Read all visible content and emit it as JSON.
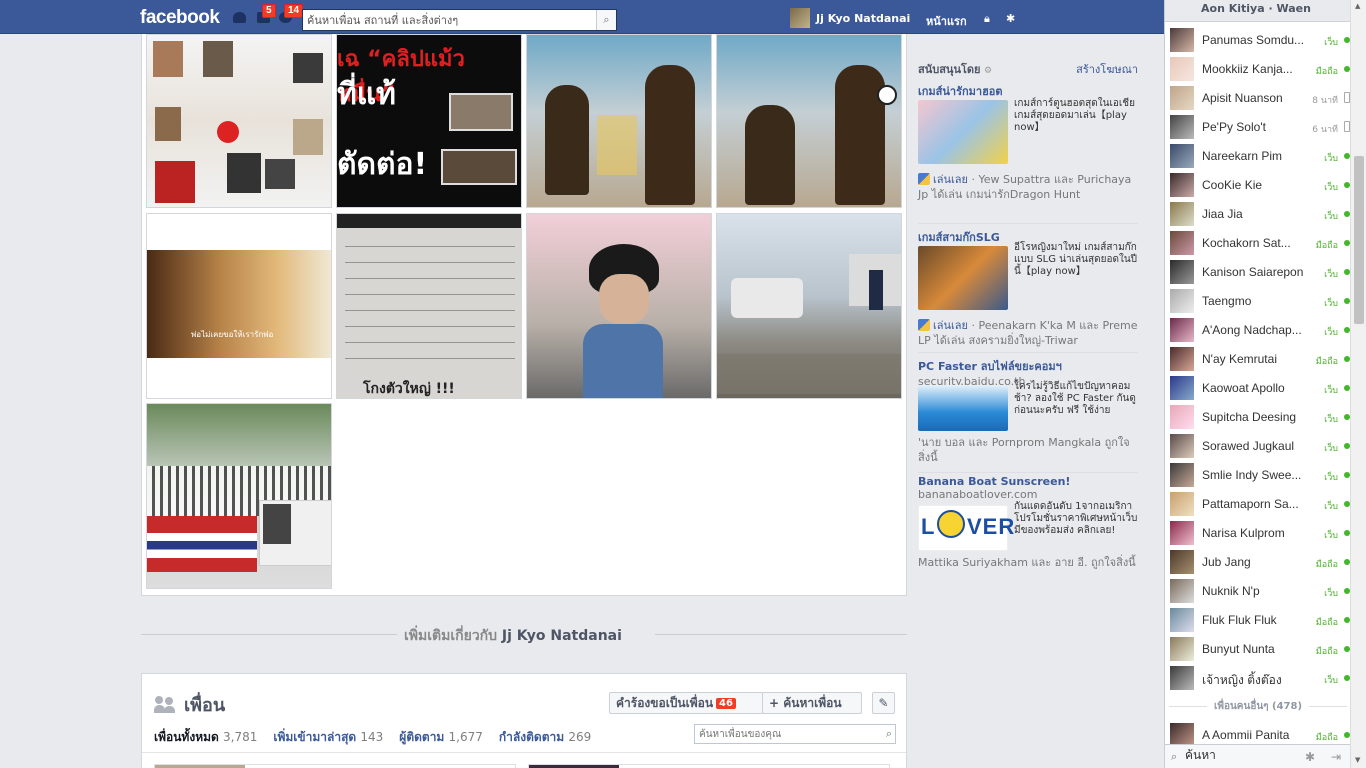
{
  "topbar": {
    "logo": "facebook",
    "friend_requests_count": "",
    "messages_count": "5",
    "notifications_count": "14",
    "search_placeholder": "ค้นหาเพื่อน สถานที่ และสิ่งต่างๆ",
    "profile_name": "Jj Kyo Natdanai",
    "home_label": "หน้าแรก"
  },
  "more_about": {
    "prefix": "เพิ่มเติมเกี่ยวกับ",
    "name": "Jj Kyo Natdanai"
  },
  "friends": {
    "title": "เพื่อน",
    "requests_label": "คำร้องขอเป็นเพื่อน",
    "requests_count": "46",
    "find_label": "+ ค้นหาเพื่อน",
    "tabs": [
      {
        "label": "เพื่อนทั้งหมด",
        "count": "3,781"
      },
      {
        "label": "เพิ่มเข้ามาล่าสุด",
        "count": "143"
      },
      {
        "label": "ผู้ติดตาม",
        "count": "1,677"
      },
      {
        "label": "กำลังติดตาม",
        "count": "269"
      }
    ],
    "search_placeholder": "ค้นหาเพื่อนของคุณ"
  },
  "sponsored": {
    "label": "สนับสนุนโดย",
    "create_ad": "สร้างโฆษณา",
    "ads": [
      {
        "title": "เกมส์น่ารักมาฮอต",
        "body": "เกมส์การ์ตูนฮอตสุดในเอเชีย เกมส์สุดยอดมาเล่น【play now】",
        "social_link": "เล่นเลย",
        "social_text": " · Yew Supattra และ Purichaya Jp ได้เล่น เกมน่ารักDragon Hunt"
      },
      {
        "title": "เกมส์สามก๊กSLG",
        "body": "อีโรหญิงมาใหม่ เกมส์สามก๊กแบบ SLG น่าเล่นสุดยอดในปีนี้【play now】",
        "social_link": "เล่นเลย",
        "social_text": " · Peenakarn K'ka M และ Preme LP ได้เล่น สงครามยิ่งใหญ่-Triwar"
      },
      {
        "title": "PC Faster ลบไฟล์ขยะคอมฯ",
        "url": "security.baidu.co.th",
        "body": "ใครไม่รู้วิธีแก้ไขปัญหาคอมช้า? ลองใช้ PC Faster กันดูก่อนนะครับ ฟรี ใช้ง่าย",
        "social_text": "'นาย บอล และ Pornprom Mangkala ถูกใจสิ่งนี้"
      },
      {
        "title": "Banana Boat Sunscreen!",
        "url": "bananaboatlover.com",
        "body": "กันแดดอันดับ 1จากอเมริกา โปรโมชั่นราคาพิเศษหน้าเว็บ มีของพร้อมส่ง คลิกเลย!",
        "social_text": "Mattika Suriyakham และ อาย อี. ถูกใจสิ่งนี้"
      }
    ]
  },
  "chat": {
    "top_partial": "Aon Kitiya · Waen",
    "contacts": [
      {
        "name": "Panumas Somdu...",
        "status": "เว็บ",
        "online": true
      },
      {
        "name": "Mookkiiz Kanja...",
        "status": "มือถือ",
        "online": true
      },
      {
        "name": "Apisit Nuanson",
        "status": "8 นาที",
        "online": false
      },
      {
        "name": "Pe'Py Solo't",
        "status": "6 นาที",
        "online": false
      },
      {
        "name": "Nareekarn Pim",
        "status": "เว็บ",
        "online": true
      },
      {
        "name": "CooKie Kie",
        "status": "เว็บ",
        "online": true
      },
      {
        "name": "Jiaa Jia",
        "status": "เว็บ",
        "online": true
      },
      {
        "name": "Kochakorn Sat...",
        "status": "มือถือ",
        "online": true
      },
      {
        "name": "Kanison Saiarepon",
        "status": "เว็บ",
        "online": true
      },
      {
        "name": "Taengmo",
        "status": "เว็บ",
        "online": true
      },
      {
        "name": "A'Aong Nadchap...",
        "status": "เว็บ",
        "online": true
      },
      {
        "name": "N'ay Kemrutai",
        "status": "มือถือ",
        "online": true
      },
      {
        "name": "Kaowoat Apollo",
        "status": "เว็บ",
        "online": true
      },
      {
        "name": "Supitcha Deesing",
        "status": "เว็บ",
        "online": true
      },
      {
        "name": "Sorawed Jugkaul",
        "status": "เว็บ",
        "online": true
      },
      {
        "name": "Smlie Indy Swee...",
        "status": "เว็บ",
        "online": true
      },
      {
        "name": "Pattamaporn Sa...",
        "status": "เว็บ",
        "online": true
      },
      {
        "name": "Narisa Kulprom",
        "status": "เว็บ",
        "online": true
      },
      {
        "name": "Jub Jang",
        "status": "มือถือ",
        "online": true
      },
      {
        "name": "Nuknik N'p",
        "status": "เว็บ",
        "online": true
      },
      {
        "name": "Fluk Fluk Fluk",
        "status": "มือถือ",
        "online": true
      },
      {
        "name": "Bunyut Nunta",
        "status": "มือถือ",
        "online": true
      },
      {
        "name": "เจ้าหญิง ติ้งต๊อง",
        "status": "เว็บ",
        "online": true
      }
    ],
    "more_friends": "เพื่อนคนอื่นๆ (478)",
    "extra_contact": {
      "name": "A Aommii Panita",
      "status": "มือถือ",
      "online": true
    },
    "search_placeholder": "ค้นหา"
  }
}
